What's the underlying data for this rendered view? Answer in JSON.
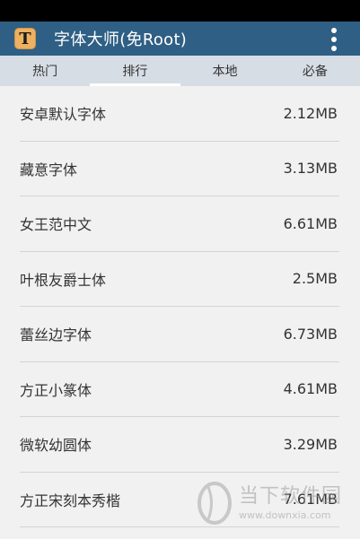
{
  "app": {
    "icon_letter": "T",
    "title": "字体大师(免Root)"
  },
  "tabs": [
    {
      "label": "热门"
    },
    {
      "label": "排行"
    },
    {
      "label": "本地"
    },
    {
      "label": "必备"
    }
  ],
  "active_tab_index": 1,
  "fonts": [
    {
      "name": "安卓默认字体",
      "size": "2.12MB"
    },
    {
      "name": "藏意字体",
      "size": "3.13MB"
    },
    {
      "name": "女王范中文",
      "size": "6.61MB"
    },
    {
      "name": "叶根友爵士体",
      "size": "2.5MB"
    },
    {
      "name": "蕾丝边字体",
      "size": "6.73MB"
    },
    {
      "name": "方正小篆体",
      "size": "4.61MB"
    },
    {
      "name": "微软幼圆体",
      "size": "3.29MB"
    },
    {
      "name": "方正宋刻本秀楷",
      "size": "7.61MB"
    }
  ],
  "watermark": {
    "name": "当下软件园",
    "url": "www.downxia.com"
  },
  "colors": {
    "appbar": "#2f5f84",
    "tabbar": "#d7dde5",
    "icon_bg": "#efb05f",
    "list_bg": "#f1f1f1"
  },
  "icons": {
    "app_icon": "letter-t-app-icon",
    "overflow": "overflow-menu-icon"
  }
}
